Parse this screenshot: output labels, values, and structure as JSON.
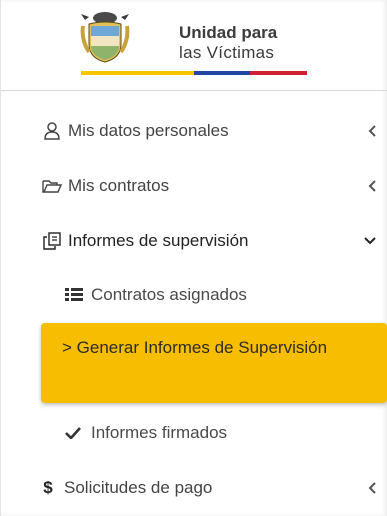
{
  "brand": {
    "line1": "Unidad para",
    "line2": "las Víctimas",
    "colors": {
      "yellow": "#f7c600",
      "blue": "#2145a3",
      "red": "#d1202f"
    }
  },
  "menu": {
    "personal": {
      "label": "Mis datos personales",
      "icon": "user-icon"
    },
    "contracts": {
      "label": "Mis contratos",
      "icon": "folder-open-icon"
    },
    "reports": {
      "label": "Informes de supervisión",
      "icon": "copy-icon",
      "submenu": {
        "assigned": {
          "label": "Contratos asignados",
          "icon": "list-icon"
        },
        "generate": {
          "label": "> Generar Informes de Supervisión"
        },
        "signed": {
          "label": "Informes firmados",
          "icon": "check-icon"
        }
      }
    },
    "payments": {
      "label": "Solicitudes de pago",
      "icon": "dollar-icon"
    }
  },
  "theme": {
    "active_bg": "#f7bd00"
  }
}
